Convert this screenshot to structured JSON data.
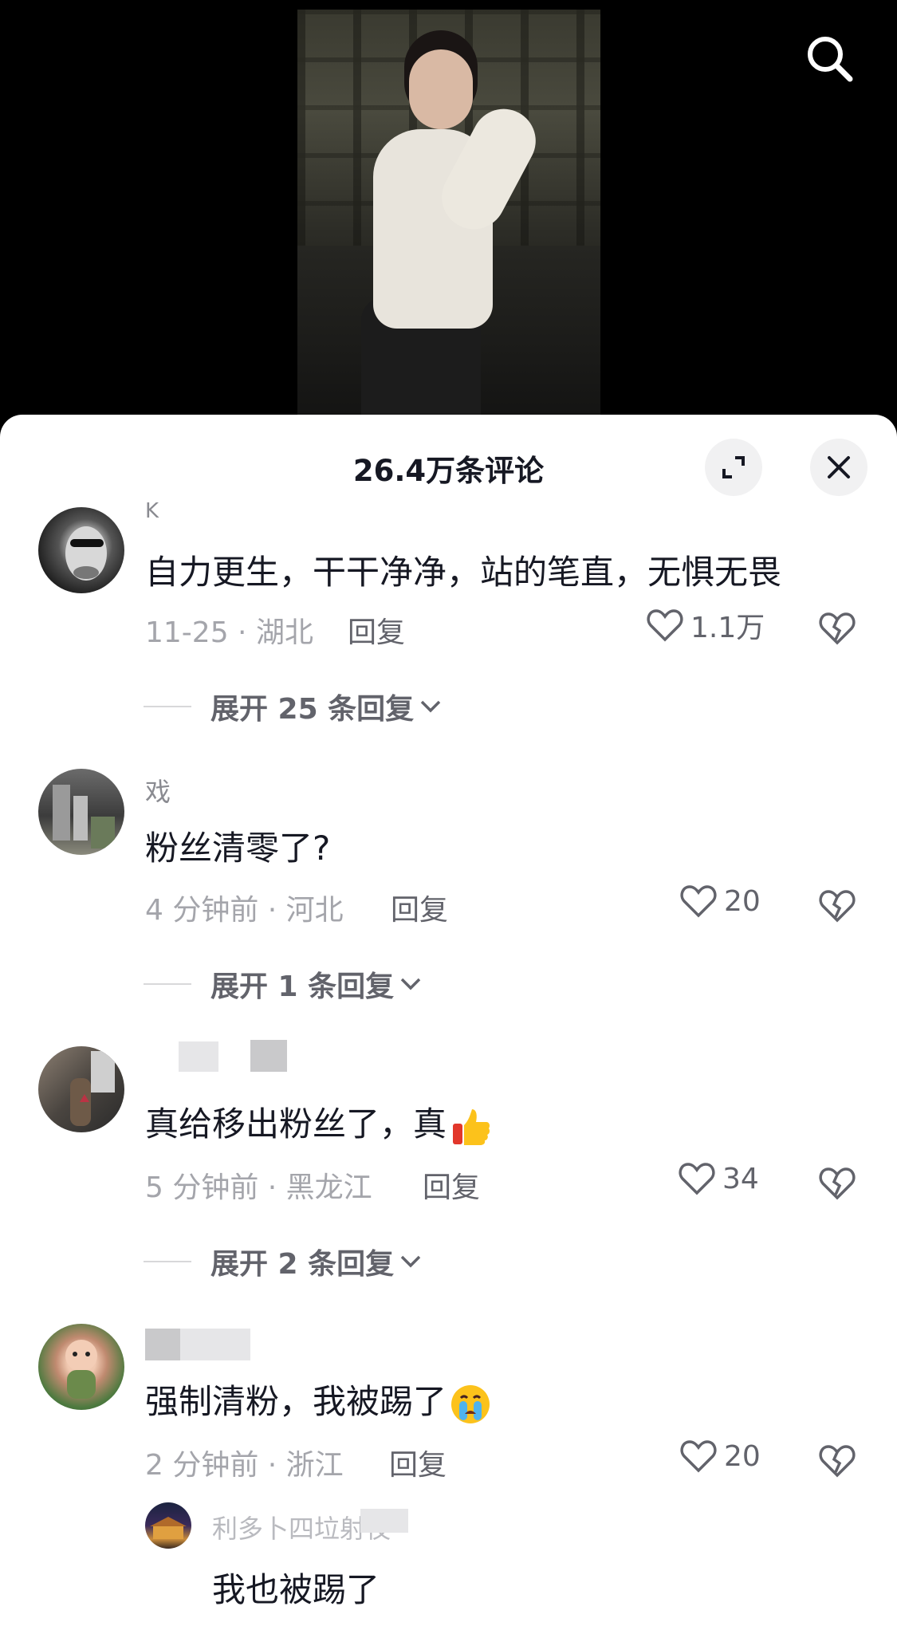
{
  "video": {
    "search_icon": "search-icon"
  },
  "sheet": {
    "title": "26.4万条评论",
    "expand_icon": "expand-icon",
    "close_icon": "close-icon"
  },
  "comments": [
    {
      "username": "K",
      "text": "自力更生，干干净净，站的笔直，无惧无畏",
      "meta": "11-25 · 湖北",
      "reply_label": "回复",
      "likes": "1.1万",
      "expand_label": "展开 25 条回复"
    },
    {
      "username": "戏",
      "text": "粉丝清零了?",
      "meta": "4 分钟前 · 河北",
      "reply_label": "回复",
      "likes": "20",
      "expand_label": "展开 1 条回复"
    },
    {
      "username": "",
      "text": "真给移出粉丝了，真",
      "emoji": "thumbs-up-emoji",
      "meta": "5 分钟前 · 黑龙江",
      "reply_label": "回复",
      "likes": "34",
      "expand_label": "展开 2 条回复"
    },
    {
      "username": "",
      "text": "强制清粉，我被踢了",
      "emoji": "crying-face-emoji",
      "meta": "2 分钟前 · 浙江",
      "reply_label": "回复",
      "likes": "20"
    }
  ],
  "sub_reply": {
    "username": "利多卜四垃射夜",
    "text": "我也被踢了"
  },
  "colors": {
    "text_primary": "#161823",
    "text_secondary": "#a4a5ab",
    "background_top": "#000000",
    "sheet_bg": "#ffffff"
  }
}
